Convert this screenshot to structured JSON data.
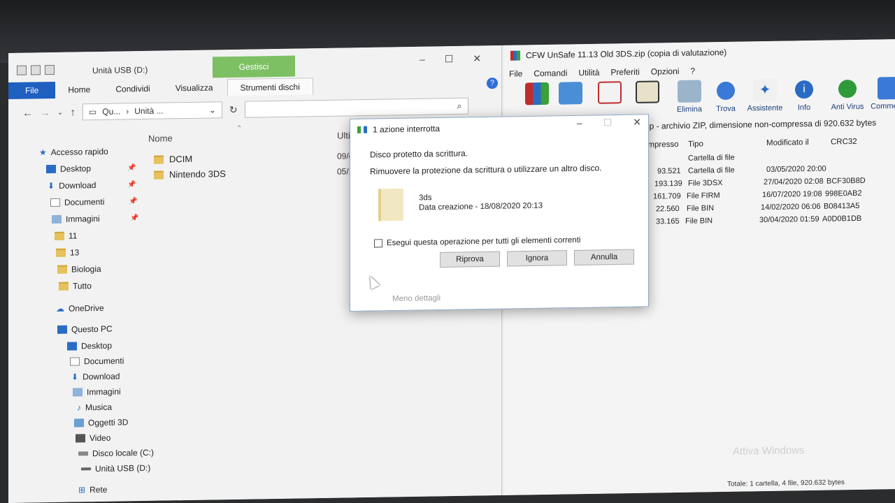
{
  "explorer": {
    "title": "Unità USB (D:)",
    "context_tab": "Gestisci",
    "ribbon_tabs": [
      "File",
      "Home",
      "Condividi",
      "Visualizza",
      "Strumenti dischi"
    ],
    "address": [
      "Qu...",
      "Unità ..."
    ],
    "sidebar": [
      {
        "label": "Accesso rapido",
        "pinned": false
      },
      {
        "label": "Desktop",
        "pinned": true
      },
      {
        "label": "Download",
        "pinned": true
      },
      {
        "label": "Documenti",
        "pinned": true
      },
      {
        "label": "Immagini",
        "pinned": true
      },
      {
        "label": "11"
      },
      {
        "label": "13"
      },
      {
        "label": "Biologia"
      },
      {
        "label": "Tutto"
      },
      {
        "label": "OneDrive"
      },
      {
        "label": "Questo PC"
      },
      {
        "label": "Desktop"
      },
      {
        "label": "Documenti"
      },
      {
        "label": "Download"
      },
      {
        "label": "Immagini"
      },
      {
        "label": "Musica"
      },
      {
        "label": "Oggetti 3D"
      },
      {
        "label": "Video"
      },
      {
        "label": "Disco locale (C:)"
      },
      {
        "label": "Unità USB (D:)"
      },
      {
        "label": "Rete"
      }
    ],
    "columns": {
      "name": "Nome",
      "modified": "Ulti"
    },
    "files": [
      {
        "name": "DCIM",
        "date": "09/("
      },
      {
        "name": "Nintendo 3DS",
        "date": "05/1"
      }
    ]
  },
  "winrar": {
    "title": "CFW UnSafe 11.13 Old 3DS.zip (copia di valutazione)",
    "menu": [
      "File",
      "Comandi",
      "Utilità",
      "Preferiti",
      "Opzioni",
      "?"
    ],
    "toolbar": [
      "Elimina",
      "Trova",
      "Assistente",
      "Info",
      "Anti Virus",
      "Commenta"
    ],
    "path": "zip - archivio ZIP, dimensione non-compressa di 920.632 bytes",
    "columns": [
      "ompresso",
      "Tipo",
      "Modificato il",
      "CRC32"
    ],
    "rows": [
      {
        "size": "",
        "type": "Cartella di file",
        "modified": "",
        "crc": ""
      },
      {
        "size": "93.521",
        "type": "Cartella di file",
        "modified": "03/05/2020 20:00",
        "crc": ""
      },
      {
        "size": "193.139",
        "type": "File 3DSX",
        "modified": "27/04/2020 02:08",
        "crc": "BCF30B8D"
      },
      {
        "size": "161.709",
        "type": "File FIRM",
        "modified": "16/07/2020 19:08",
        "crc": "998E0AB2"
      },
      {
        "size": "22.560",
        "type": "File BIN",
        "modified": "14/02/2020 06:06",
        "crc": "B08413A5"
      },
      {
        "size": "33.165",
        "type": "File BIN",
        "modified": "30/04/2020 01:59",
        "crc": "A0D0B1DB"
      }
    ],
    "status": "Totale: 1 cartella, 4 file, 920.632 bytes",
    "watermark": "Attiva Windows"
  },
  "dialog": {
    "title": "1 azione interrotta",
    "message1": "Disco protetto da scrittura.",
    "message2": "Rimuovere la protezione da scrittura o utilizzare un altro disco.",
    "file_name": "3ds",
    "file_date": "Data creazione - 18/08/2020 20:13",
    "checkbox_label": "Esegui questa operazione per tutti gli elementi correnti",
    "buttons": {
      "retry": "Riprova",
      "skip": "Ignora",
      "cancel": "Annulla"
    },
    "less_details": "Meno dettagli"
  },
  "colors": {
    "accent": "#1f5fbf",
    "context_tab": "#7cc063"
  }
}
